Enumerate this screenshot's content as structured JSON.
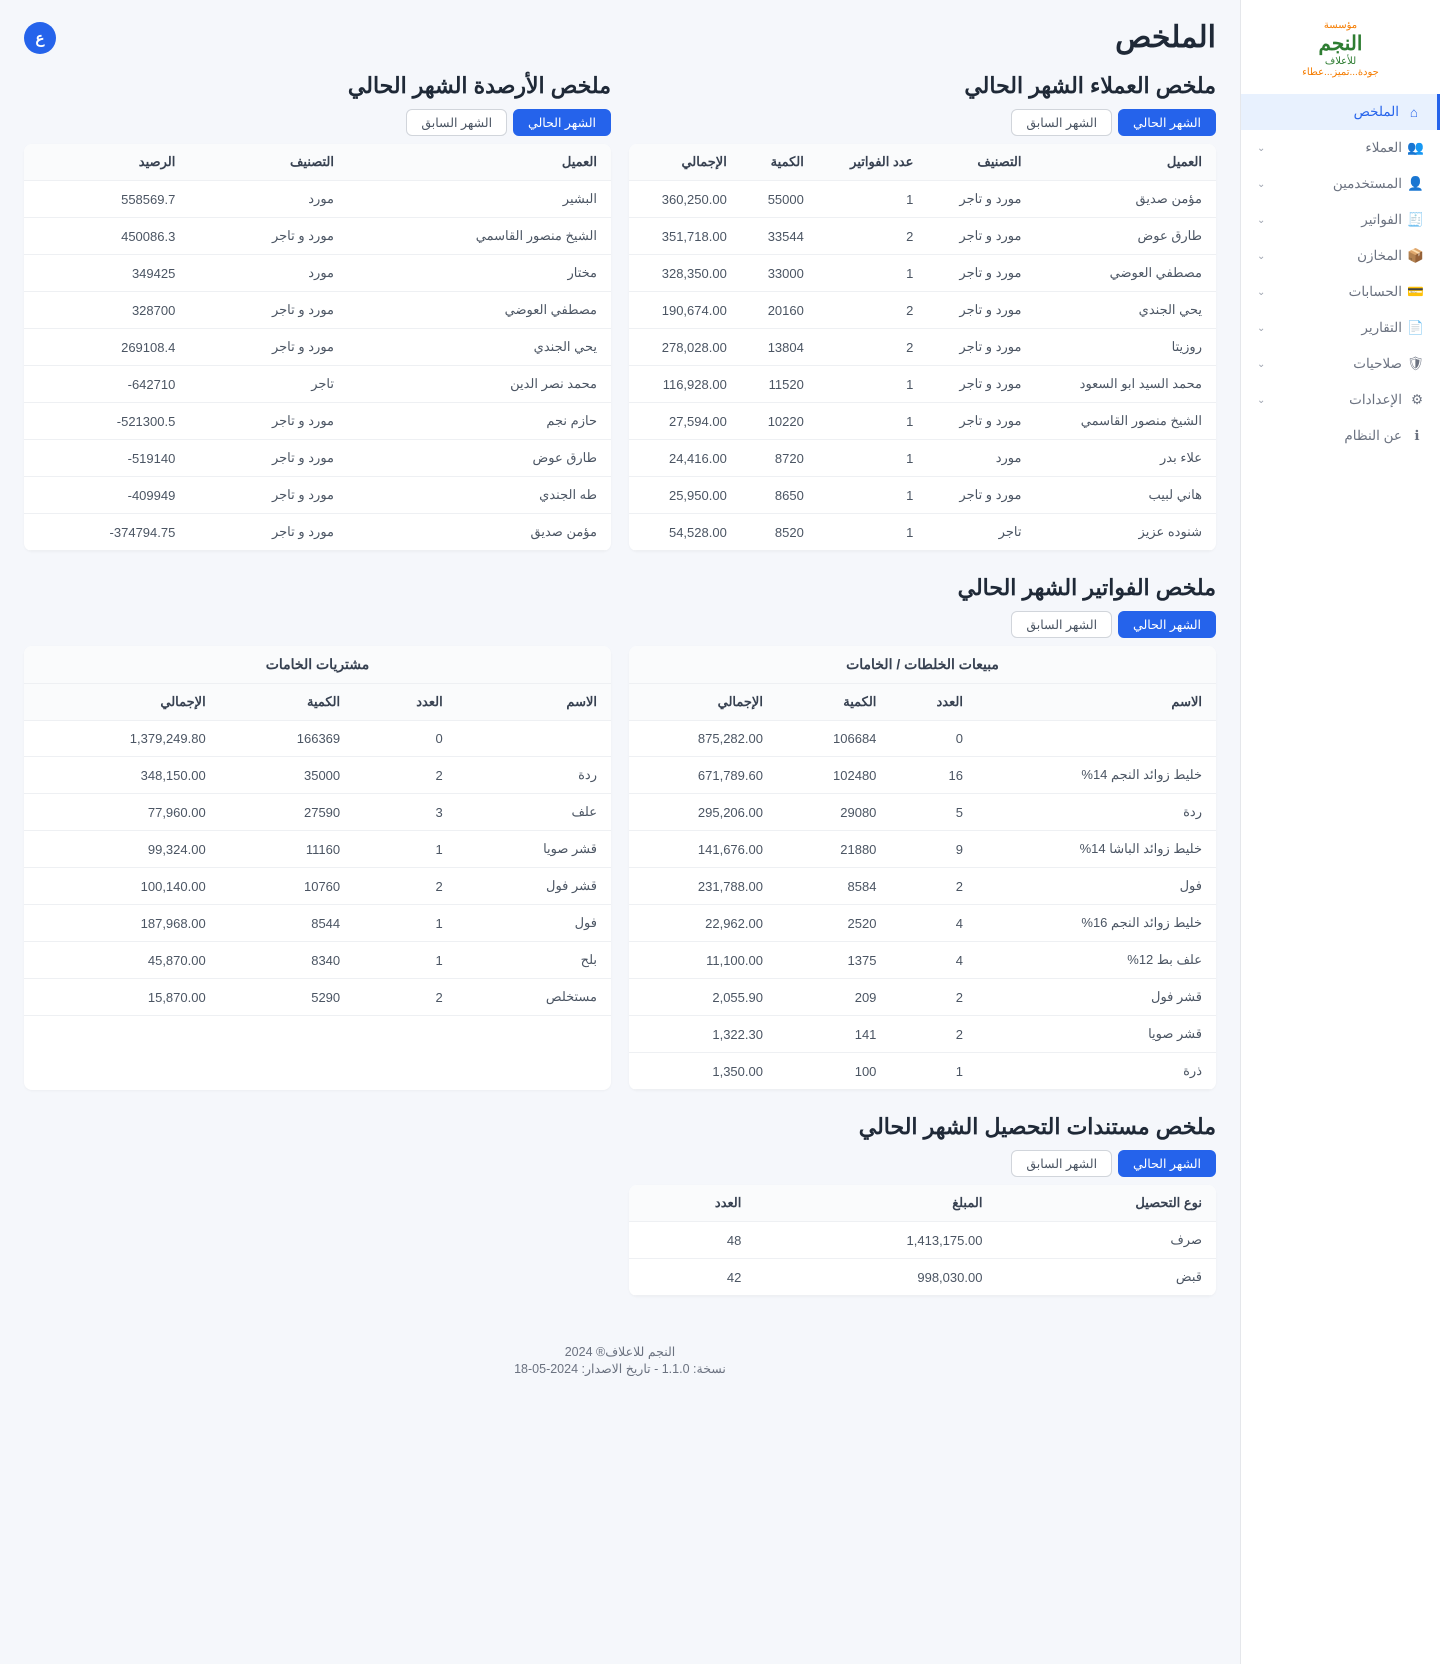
{
  "brand": {
    "name": "النجم",
    "tag1": "مؤسسة",
    "tag2": "للأعلاف",
    "slogan": "جودة...تميز...عطاء"
  },
  "badge": "ع",
  "page_title": "الملخص",
  "nav": [
    {
      "label": "الملخص",
      "icon": "⌂",
      "active": true,
      "expandable": false
    },
    {
      "label": "العملاء",
      "icon": "👥",
      "expandable": true
    },
    {
      "label": "المستخدمين",
      "icon": "👤",
      "expandable": true
    },
    {
      "label": "الفواتير",
      "icon": "🧾",
      "expandable": true
    },
    {
      "label": "المخازن",
      "icon": "📦",
      "expandable": true
    },
    {
      "label": "الحسابات",
      "icon": "💳",
      "expandable": true
    },
    {
      "label": "التقارير",
      "icon": "📄",
      "expandable": true
    },
    {
      "label": "صلاحيات",
      "icon": "🛡",
      "expandable": true
    },
    {
      "label": "الإعدادات",
      "icon": "⚙",
      "expandable": true
    },
    {
      "label": "عن النظام",
      "icon": "ℹ",
      "expandable": false
    }
  ],
  "tabs": {
    "current": "الشهر الحالي",
    "previous": "الشهر السابق"
  },
  "customers": {
    "title": "ملخص العملاء الشهر الحالي",
    "headers": [
      "العميل",
      "التصنيف",
      "عدد الفواتير",
      "الكمية",
      "الإجمالي"
    ],
    "rows": [
      [
        "مؤمن صديق",
        "مورد و تاجر",
        "1",
        "55000",
        "360,250.00"
      ],
      [
        "طارق عوض",
        "مورد و تاجر",
        "2",
        "33544",
        "351,718.00"
      ],
      [
        "مصطفي العوضي",
        "مورد و تاجر",
        "1",
        "33000",
        "328,350.00"
      ],
      [
        "يحي الجندي",
        "مورد و تاجر",
        "2",
        "20160",
        "190,674.00"
      ],
      [
        "روزيتا",
        "مورد و تاجر",
        "2",
        "13804",
        "278,028.00"
      ],
      [
        "محمد السيد ابو السعود",
        "مورد و تاجر",
        "1",
        "11520",
        "116,928.00"
      ],
      [
        "الشيخ منصور القاسمي",
        "مورد و تاجر",
        "1",
        "10220",
        "27,594.00"
      ],
      [
        "علاء بدر",
        "مورد",
        "1",
        "8720",
        "24,416.00"
      ],
      [
        "هاني لبيب",
        "مورد و تاجر",
        "1",
        "8650",
        "25,950.00"
      ],
      [
        "شنوده عزيز",
        "تاجر",
        "1",
        "8520",
        "54,528.00"
      ]
    ]
  },
  "balances": {
    "title": "ملخص الأرصدة الشهر الحالي",
    "headers": [
      "العميل",
      "التصنيف",
      "الرصيد"
    ],
    "rows": [
      [
        "البشير",
        "مورد",
        "558569.7"
      ],
      [
        "الشيخ منصور القاسمي",
        "مورد و تاجر",
        "450086.3"
      ],
      [
        "مختار",
        "مورد",
        "349425"
      ],
      [
        "مصطفي العوضي",
        "مورد و تاجر",
        "328700"
      ],
      [
        "يحي الجندي",
        "مورد و تاجر",
        "269108.4"
      ],
      [
        "محمد نصر الدين",
        "تاجر",
        "642710-"
      ],
      [
        "حازم نجم",
        "مورد و تاجر",
        "521300.5-"
      ],
      [
        "طارق عوض",
        "مورد و تاجر",
        "519140-"
      ],
      [
        "طه الجندي",
        "مورد و تاجر",
        "409949-"
      ],
      [
        "مؤمن صديق",
        "مورد و تاجر",
        "374794.75-"
      ]
    ]
  },
  "invoices": {
    "title": "ملخص الفواتير الشهر الحالي",
    "sales_head": "مبيعات الخلطات / الخامات",
    "purch_head": "مشتريات الخامات",
    "headers": [
      "الاسم",
      "العدد",
      "الكمية",
      "الإجمالي"
    ],
    "sales": [
      [
        "",
        "0",
        "106684",
        "875,282.00"
      ],
      [
        "خليط زوائد النجم 14%",
        "16",
        "102480",
        "671,789.60"
      ],
      [
        "ردة",
        "5",
        "29080",
        "295,206.00"
      ],
      [
        "خليط زوائد الباشا 14%",
        "9",
        "21880",
        "141,676.00"
      ],
      [
        "فول",
        "2",
        "8584",
        "231,788.00"
      ],
      [
        "خليط زوائد النجم 16%",
        "4",
        "2520",
        "22,962.00"
      ],
      [
        "علف بط 12%",
        "4",
        "1375",
        "11,100.00"
      ],
      [
        "قشر فول",
        "2",
        "209",
        "2,055.90"
      ],
      [
        "قشر صويا",
        "2",
        "141",
        "1,322.30"
      ],
      [
        "ذرة",
        "1",
        "100",
        "1,350.00"
      ]
    ],
    "purchases": [
      [
        "",
        "0",
        "166369",
        "1,379,249.80"
      ],
      [
        "ردة",
        "2",
        "35000",
        "348,150.00"
      ],
      [
        "علف",
        "3",
        "27590",
        "77,960.00"
      ],
      [
        "قشر صويا",
        "1",
        "11160",
        "99,324.00"
      ],
      [
        "قشر فول",
        "2",
        "10760",
        "100,140.00"
      ],
      [
        "فول",
        "1",
        "8544",
        "187,968.00"
      ],
      [
        "بلح",
        "1",
        "8340",
        "45,870.00"
      ],
      [
        "مستخلص",
        "2",
        "5290",
        "15,870.00"
      ]
    ]
  },
  "collection": {
    "title": "ملخص مستندات التحصيل الشهر الحالي",
    "headers": [
      "نوع التحصيل",
      "المبلغ",
      "العدد"
    ],
    "rows": [
      [
        "صرف",
        "1,413,175.00",
        "48"
      ],
      [
        "قبض",
        "998,030.00",
        "42"
      ]
    ]
  },
  "footer": {
    "l1": "النجم للاعلاف® 2024",
    "l2": "نسخة: 1.1.0 - تاريخ الاصدار: 2024-05-18"
  }
}
